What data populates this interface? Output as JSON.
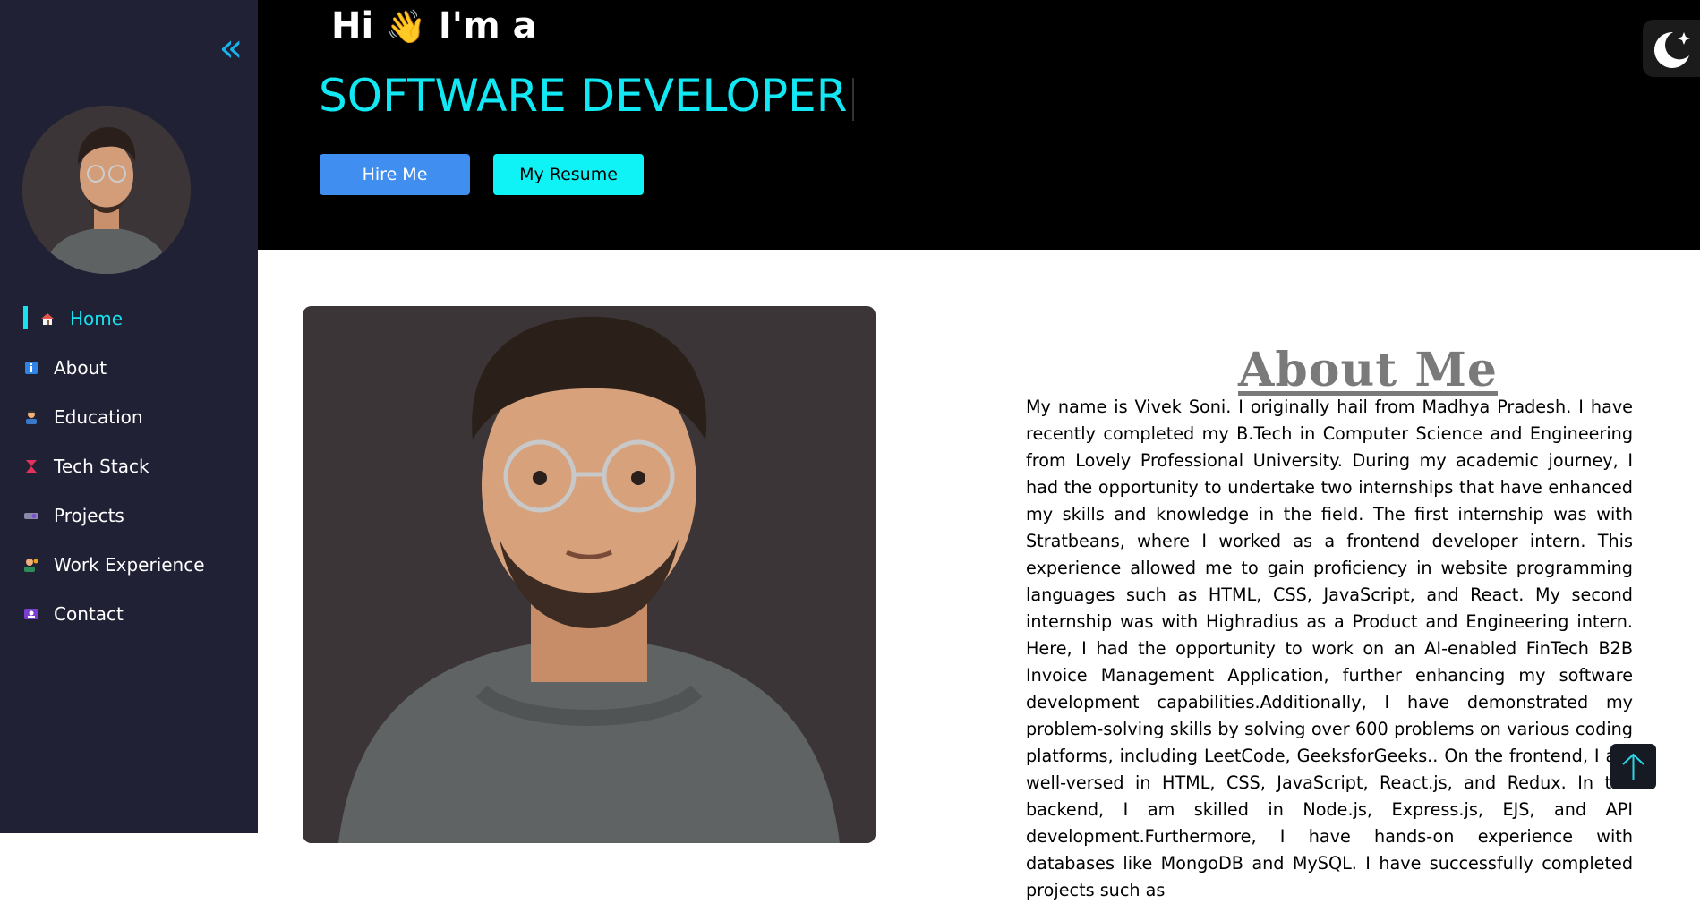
{
  "sidebar": {
    "collapse_glyph": "«",
    "collapse_icon": "double-chevron-left-icon",
    "items": [
      {
        "label": "Home",
        "icon": "home-icon",
        "active": true
      },
      {
        "label": "About",
        "icon": "info-icon",
        "active": false
      },
      {
        "label": "Education",
        "icon": "student-icon",
        "active": false
      },
      {
        "label": "Tech Stack",
        "icon": "hourglass-icon",
        "active": false
      },
      {
        "label": "Projects",
        "icon": "projector-icon",
        "active": false
      },
      {
        "label": "Work Experience",
        "icon": "worker-icon",
        "active": false
      },
      {
        "label": "Contact",
        "icon": "contact-card-icon",
        "active": false
      }
    ]
  },
  "hero": {
    "greeting": "Hi",
    "wave_emoji": "👋",
    "intro": "I'm a",
    "role": "SOFTWARE DEVELOPER",
    "hire_label": "Hire Me",
    "resume_label": "My Resume"
  },
  "about": {
    "title": "About Me",
    "text": "My name is Vivek Soni. I originally hail from Madhya Pradesh. I have recently completed my B.Tech in Computer Science and Engineering from Lovely Professional University. During my academic journey, I had the opportunity to undertake two internships that have enhanced my skills and knowledge in the field. The first internship was with Stratbeans, where I worked as a frontend developer intern. This experience allowed me to gain proficiency in website programming languages such as HTML, CSS, JavaScript, and React. My second internship was with Highradius as a Product and Engineering intern. Here, I had the opportunity to work on an AI-enabled FinTech B2B Invoice Management Application, further enhancing my software development capabilities.Additionally, I have demonstrated my problem-solving skills by solving over 600 problems on various coding platforms, including LeetCode, GeeksforGeeks.. On the frontend, I am well-versed in HTML, CSS, JavaScript, React.js, and Redux. In the backend, I am skilled in Node.js, Express.js, EJS, and API development.Furthermore, I have hands-on experience with databases like MongoDB and MySQL. I have successfully completed projects such as"
  },
  "colors": {
    "sidebar_bg": "#212135",
    "accent_cyan": "#17e3ee",
    "hire_button": "#3f8ef0",
    "resume_button": "#10f3f6",
    "hero_bg": "#000000"
  }
}
